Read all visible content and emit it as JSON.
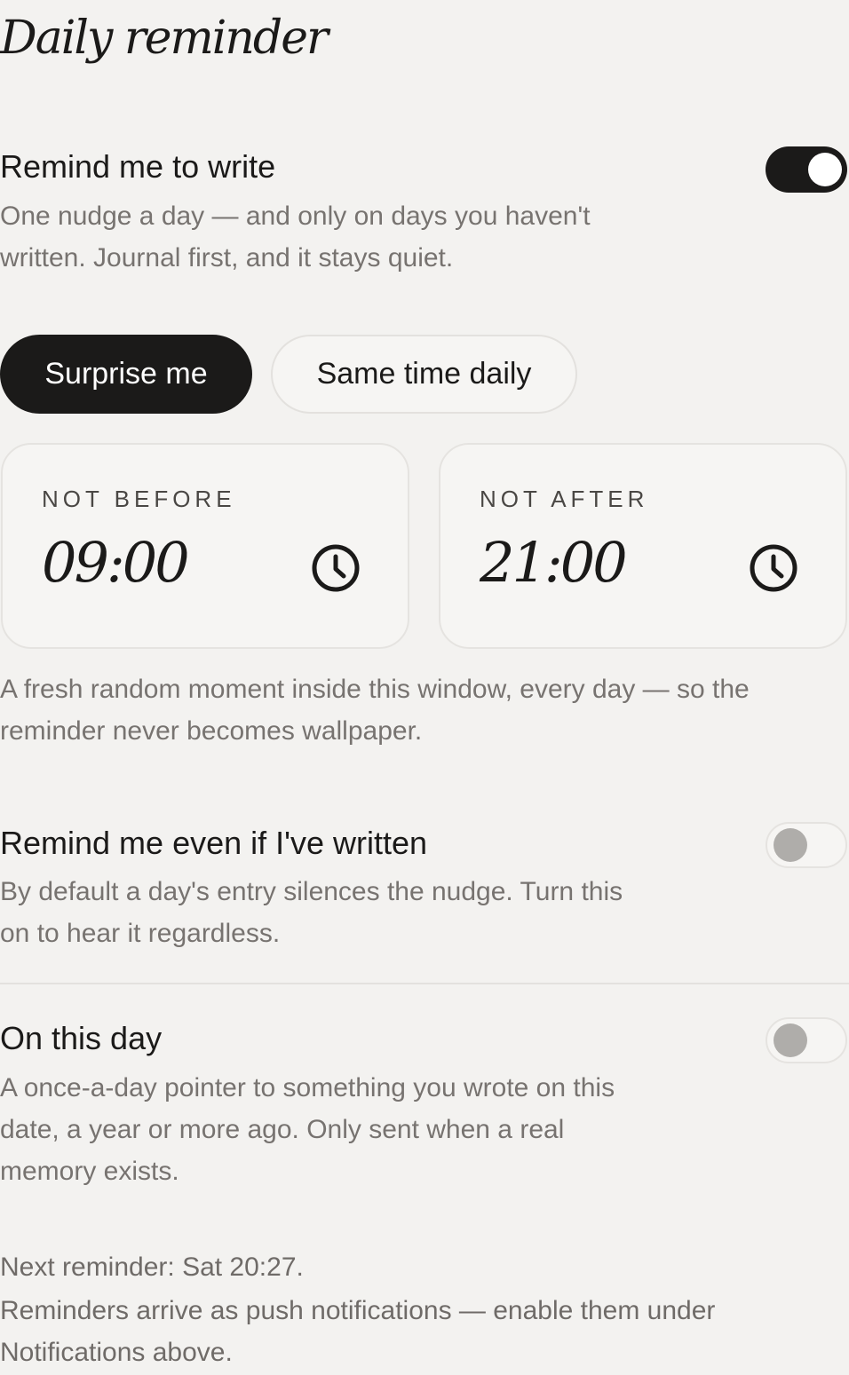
{
  "header": {
    "title": "Daily reminder"
  },
  "remind_to_write": {
    "title": "Remind me to write",
    "description_line1": "One nudge a day — and only on days you haven't",
    "description_line2": "written. Journal first, and it stays quiet.",
    "enabled": true
  },
  "mode": {
    "options": [
      "Surprise me",
      "Same time daily"
    ],
    "selected": "Surprise me"
  },
  "window": {
    "not_before_label": "NOT BEFORE",
    "not_before_value": "09:00",
    "not_after_label": "NOT AFTER",
    "not_after_value": "21:00",
    "icon": "clock-icon",
    "description_line1": "A fresh random moment inside this window, every day — so the",
    "description_line2": "reminder never becomes wallpaper."
  },
  "remind_even_if_written": {
    "title": "Remind me even if I've written",
    "description_line1": "By default a day's entry silences the nudge. Turn this",
    "description_line2": "on to hear it regardless.",
    "enabled": false
  },
  "on_this_day": {
    "title": "On this day",
    "description_line1": "A once-a-day pointer to something you wrote on this",
    "description_line2": "date, a year or more ago. Only sent when a real",
    "description_line3": "memory exists.",
    "enabled": false
  },
  "footer": {
    "next_reminder": "Next reminder: Sat 20:27.",
    "notice_line1": "Reminders arrive as push notifications — enable them under",
    "notice_line2": "Notifications above."
  },
  "colors": {
    "background": "#f3f2f0",
    "primary": "#1b1a19",
    "muted_text": "#777370"
  }
}
